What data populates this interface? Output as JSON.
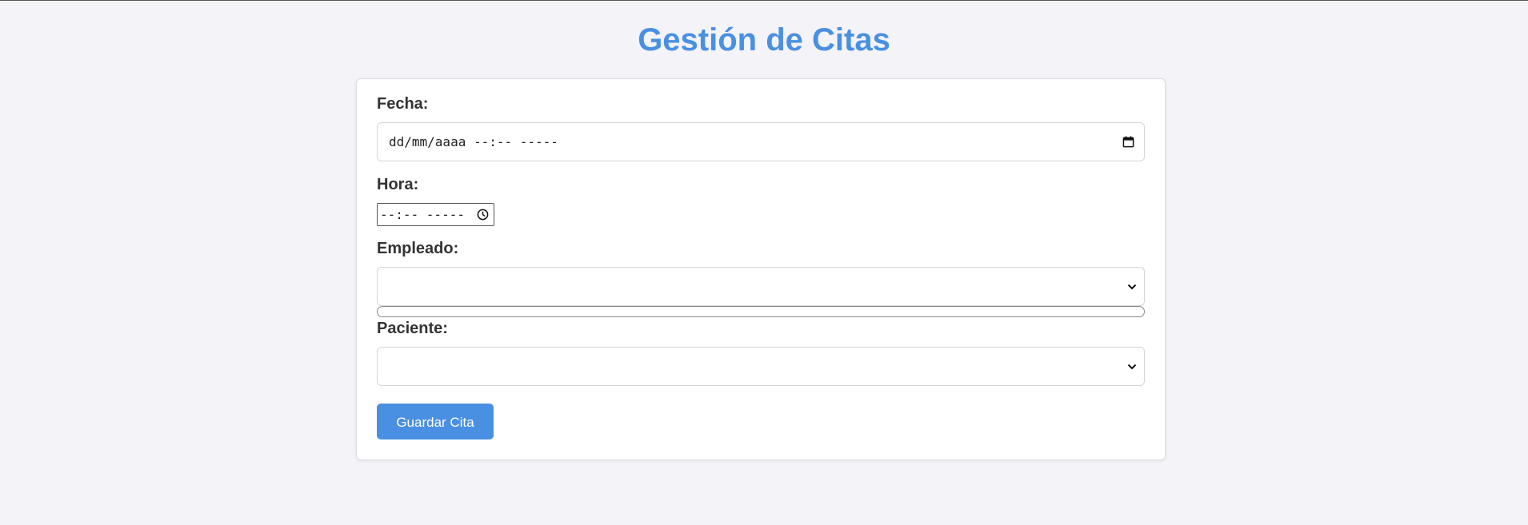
{
  "page": {
    "title": "Gestión de Citas"
  },
  "form": {
    "fecha": {
      "label": "Fecha:",
      "placeholder": "dd/mm/aaaa --:-- -----"
    },
    "hora": {
      "label": "Hora:",
      "placeholder": "--:-- -----"
    },
    "empleado": {
      "label": "Empleado:",
      "selected": ""
    },
    "paciente": {
      "label": "Paciente:",
      "selected": ""
    },
    "submit_label": "Guardar Cita"
  },
  "colors": {
    "accent": "#4a90e2",
    "background": "#f3f3f8"
  },
  "icons": {
    "fecha": "calendar-icon",
    "hora": "clock-icon",
    "select": "chevron-down-icon"
  }
}
